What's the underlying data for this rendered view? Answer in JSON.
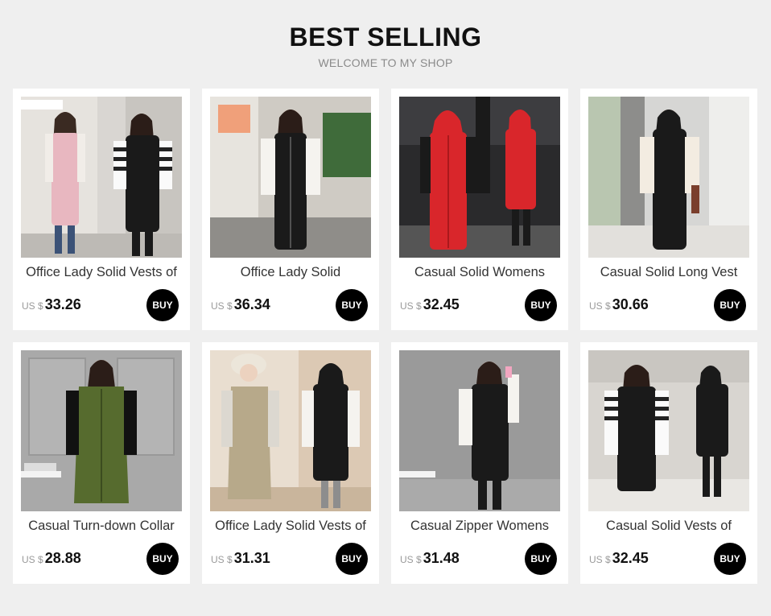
{
  "header": {
    "title": "BEST SELLING",
    "subtitle": "WELCOME TO MY SHOP"
  },
  "products": [
    {
      "name": "Office Lady Solid Vests of",
      "currency": "US $",
      "price": "33.26",
      "buy_label": "BUY"
    },
    {
      "name": "Office Lady Solid",
      "currency": "US $",
      "price": "36.34",
      "buy_label": "BUY"
    },
    {
      "name": "Casual Solid Womens",
      "currency": "US $",
      "price": "32.45",
      "buy_label": "BUY"
    },
    {
      "name": "Casual Solid Long Vest",
      "currency": "US $",
      "price": "30.66",
      "buy_label": "BUY"
    },
    {
      "name": "Casual Turn-down Collar",
      "currency": "US $",
      "price": "28.88",
      "buy_label": "BUY"
    },
    {
      "name": "Office Lady Solid Vests of",
      "currency": "US $",
      "price": "31.31",
      "buy_label": "BUY"
    },
    {
      "name": "Casual Zipper Womens",
      "currency": "US $",
      "price": "31.48",
      "buy_label": "BUY"
    },
    {
      "name": "Casual Solid Vests of",
      "currency": "US $",
      "price": "32.45",
      "buy_label": "BUY"
    }
  ],
  "colors": {
    "page_bg": "#efefef",
    "card_bg": "#ffffff",
    "buy_button": "#000000",
    "vest_pink": "#e8b7c0",
    "vest_black": "#1a1a1a",
    "vest_red": "#d9262b",
    "vest_olive": "#566b2e",
    "vest_khaki": "#b7a98a"
  }
}
